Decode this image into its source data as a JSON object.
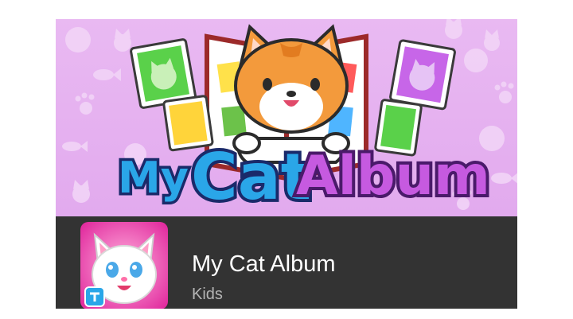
{
  "app": {
    "title": "My Cat Album",
    "category": "Kids"
  },
  "banner": {
    "logo_words": [
      "My",
      "Cat",
      "Album"
    ],
    "background_color": "#e6b3f0",
    "icons": [
      "yarn-ball-pattern",
      "fish-pattern",
      "paw-print-pattern",
      "cat-head-pattern"
    ]
  },
  "colors": {
    "info_bar": "#333333",
    "title_text": "#ffffff",
    "category_text": "#b5b5b5",
    "logo_blue": "#2aa6e8",
    "logo_purple": "#b84fd4",
    "cat_orange": "#f39a3c"
  }
}
